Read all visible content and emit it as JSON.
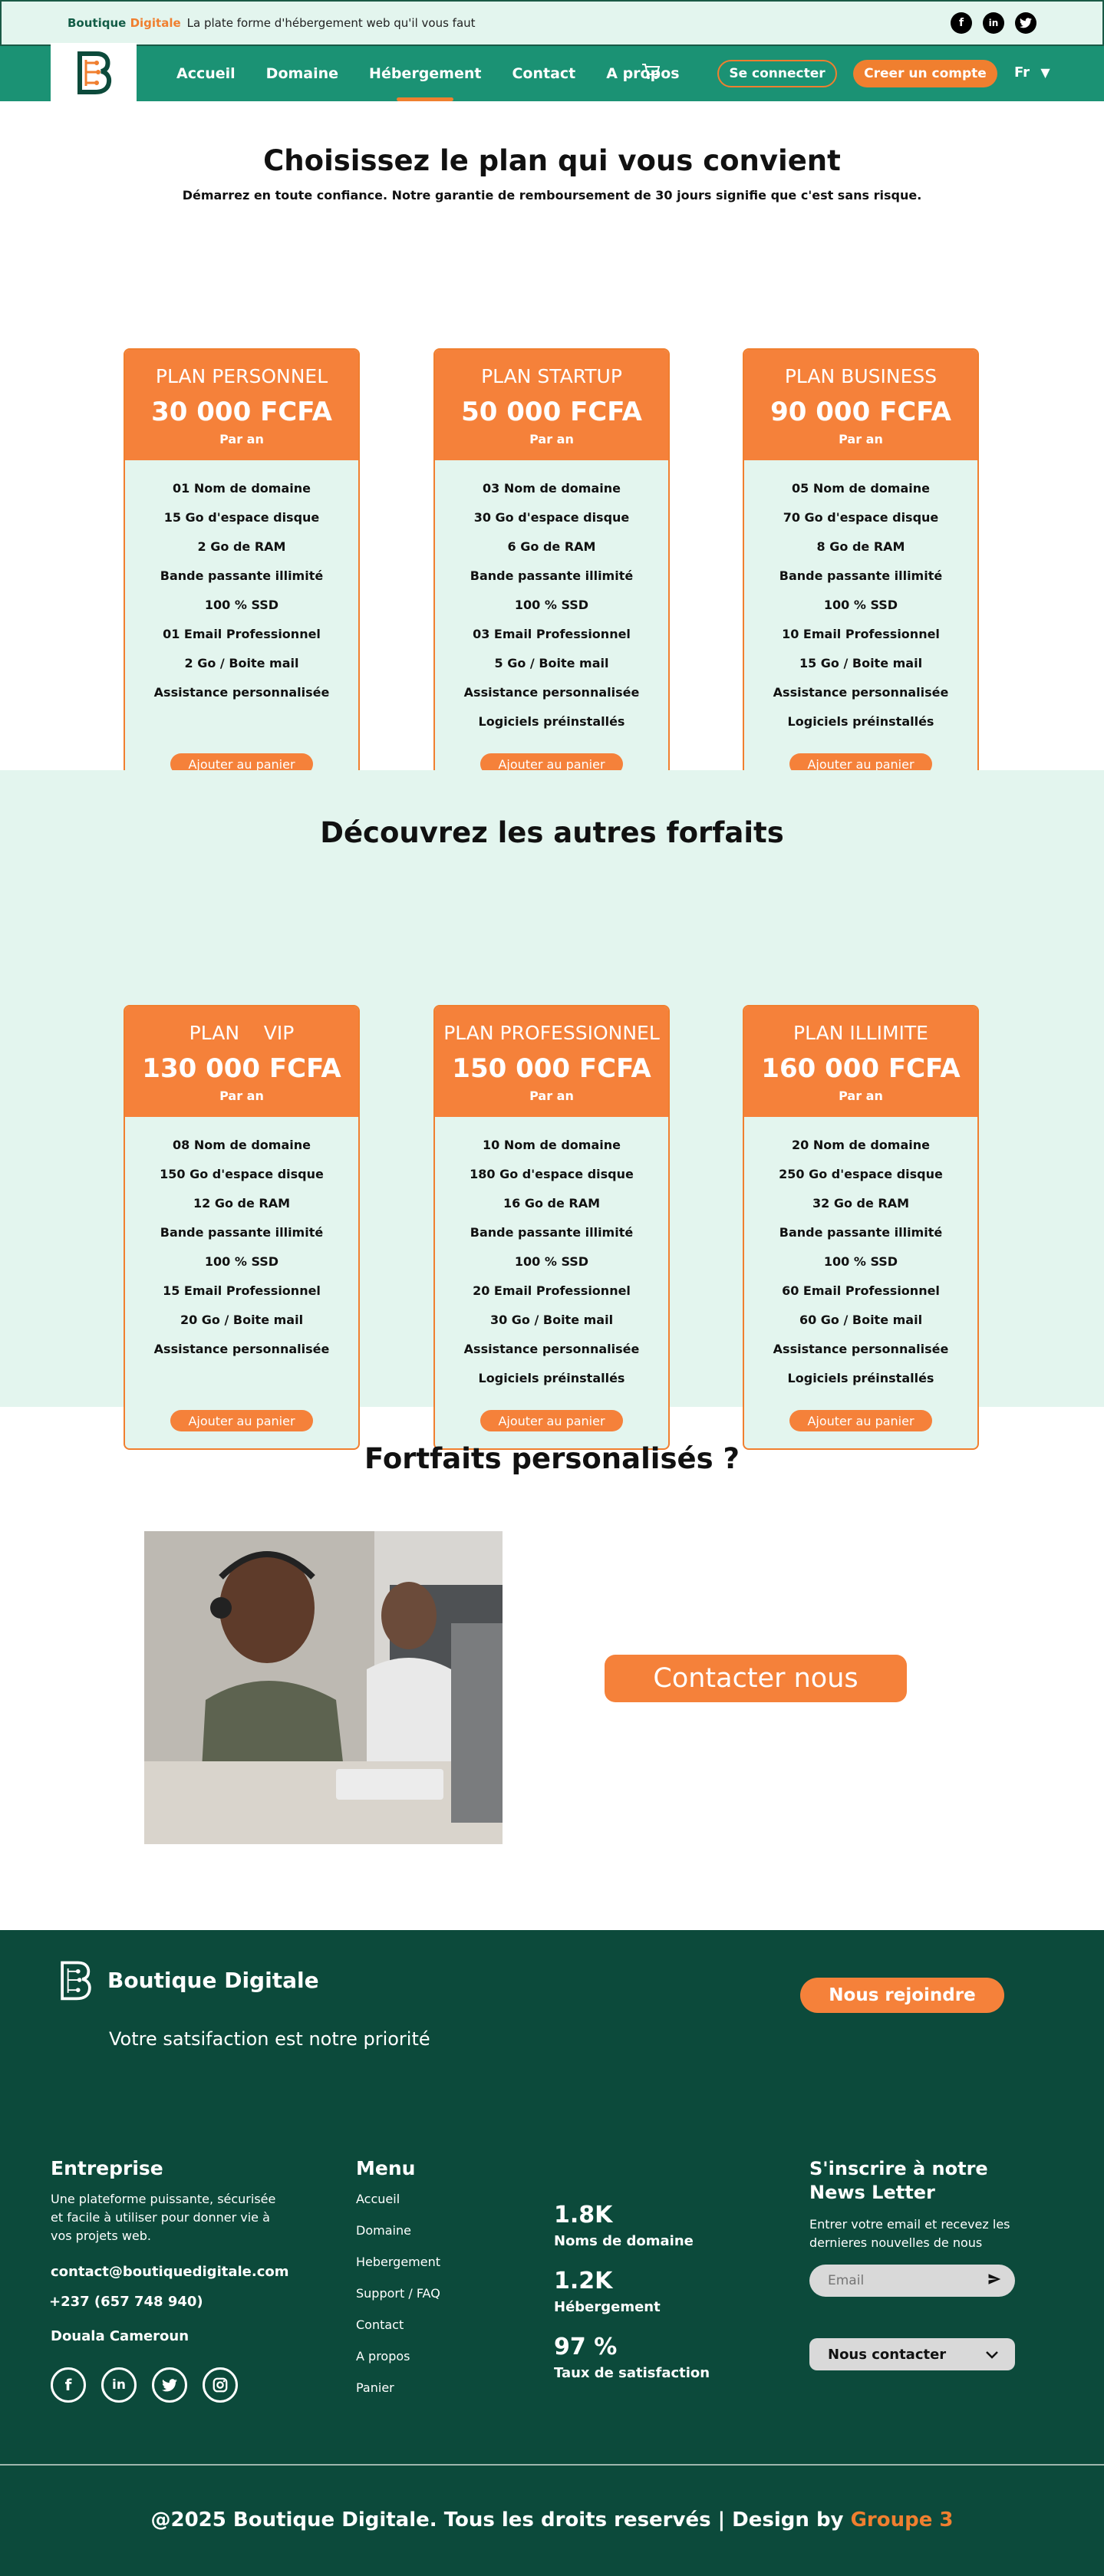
{
  "topbar": {
    "brand_part1": "Boutique",
    "brand_part2": "Digitale",
    "tagline": "La plate forme d'hébergement web qu'il vous faut"
  },
  "nav": {
    "items": [
      "Accueil",
      "Domaine",
      "Hébergement",
      "Contact",
      "A propos"
    ],
    "active": "Hébergement",
    "login": "Se connecter",
    "signup": "Creer un compte",
    "lang": "Fr"
  },
  "section1": {
    "title": "Choisissez le plan qui vous convient",
    "subtitle": "Démarrez en toute confiance. Notre garantie de remboursement de 30 jours signifie que c'est sans risque."
  },
  "plans_main": [
    {
      "name": "PLAN PERSONNEL",
      "price": "30 000 FCFA",
      "period": "Par an",
      "features": [
        "01 Nom de domaine",
        "15 Go d'espace disque",
        "2 Go de RAM",
        "Bande passante illimité",
        "100 % SSD",
        "01 Email Professionnel",
        "2 Go / Boite mail",
        "Assistance personnalisée"
      ],
      "button": "Ajouter au panier"
    },
    {
      "name": "PLAN STARTUP",
      "price": "50 000 FCFA",
      "period": "Par an",
      "features": [
        "03 Nom de domaine",
        "30 Go d'espace disque",
        "6 Go de RAM",
        "Bande passante illimité",
        "100 % SSD",
        "03 Email Professionnel",
        "5 Go / Boite mail",
        "Assistance personnalisée",
        "Logiciels préinstallés"
      ],
      "button": "Ajouter au panier"
    },
    {
      "name": "PLAN BUSINESS",
      "price": "90 000 FCFA",
      "period": "Par an",
      "features": [
        "05 Nom de domaine",
        "70 Go d'espace disque",
        "8 Go de RAM",
        "Bande passante illimité",
        "100 % SSD",
        "10 Email Professionnel",
        "15 Go / Boite mail",
        "Assistance personnalisée",
        "Logiciels préinstallés"
      ],
      "button": "Ajouter au panier"
    }
  ],
  "section2": {
    "title": "Découvrez les autres forfaits"
  },
  "plans_other": [
    {
      "name": "PLAN    VIP",
      "price": "130 000 FCFA",
      "period": "Par an",
      "features": [
        "08 Nom de domaine",
        "150 Go d'espace disque",
        "12 Go de RAM",
        "Bande passante illimité",
        "100 % SSD",
        "15 Email Professionnel",
        "20 Go / Boite mail",
        "Assistance personnalisée"
      ],
      "button": "Ajouter au panier"
    },
    {
      "name": "PLAN PROFESSIONNEL",
      "price": "150 000 FCFA",
      "period": "Par an",
      "features": [
        "10 Nom de domaine",
        "180 Go d'espace disque",
        "16 Go de RAM",
        "Bande passante illimité",
        "100 % SSD",
        "20 Email Professionnel",
        "30 Go / Boite mail",
        "Assistance personnalisée",
        "Logiciels préinstallés"
      ],
      "button": "Ajouter au panier"
    },
    {
      "name": "PLAN ILLIMITE",
      "price": "160 000 FCFA",
      "period": "Par an",
      "features": [
        "20 Nom de domaine",
        "250 Go d'espace disque",
        "32 Go de RAM",
        "Bande passante illimité",
        "100 % SSD",
        "60 Email Professionnel",
        "60 Go / Boite mail",
        "Assistance personnalisée",
        "Logiciels préinstallés"
      ],
      "button": "Ajouter au panier"
    }
  ],
  "section3": {
    "title": "Fortfaits personalisés ?",
    "contact_button": "Contacter nous"
  },
  "footer": {
    "brand": "Boutique Digitale",
    "slogan": "Votre satsifaction est notre priorité",
    "join": "Nous rejoindre",
    "company_title": "Entreprise",
    "company_desc": "Une plateforme puissante, sécurisée et facile à utiliser pour donner vie à vos projets web.",
    "email": "contact@boutiquedigitale.com",
    "phone": "+237 (657 748 940)",
    "city": "Douala Cameroun",
    "menu_title": "Menu",
    "menu_links": [
      "Accueil",
      "Domaine",
      "Hebergement",
      "Support / FAQ",
      "Contact",
      "A propos",
      "Panier"
    ],
    "stats": [
      {
        "value": "1.8K",
        "label": "Noms de domaine"
      },
      {
        "value": "1.2K",
        "label": "Hébergement"
      },
      {
        "value": "97 %",
        "label": "Taux de satisfaction"
      }
    ],
    "newsletter_title": "S'inscrire à notre News Letter",
    "newsletter_desc": "Entrer votre email et recevez les dernieres nouvelles de nous",
    "email_placeholder": "Email",
    "contact_select": "Nous contacter",
    "copyright_main": "@2025 Boutique Digitale. Tous les droits reservés | Design by",
    "copyright_group": "Groupe 3"
  },
  "colors": {
    "brand_green": "#1b9274",
    "dark_green": "#0c4a3b",
    "mint": "#e3f5ee",
    "orange": "#f5813a"
  }
}
